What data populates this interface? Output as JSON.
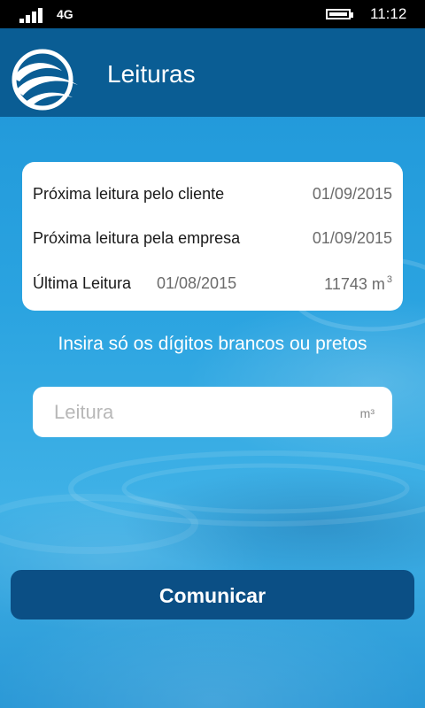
{
  "status_bar": {
    "network": "4G",
    "time": "11:12",
    "icons": [
      "signal-icon",
      "battery-icon"
    ]
  },
  "header": {
    "title": "Leituras",
    "logo": "water-wave-logo"
  },
  "info_card": {
    "next_reading_client": {
      "label": "Próxima leitura pelo cliente",
      "date": "01/09/2015"
    },
    "next_reading_company": {
      "label": "Próxima leitura pela empresa",
      "date": "01/09/2015"
    },
    "last_reading": {
      "label": "Última Leitura",
      "date": "01/08/2015",
      "value": "11743 m",
      "unit_power": "3"
    }
  },
  "instruction": "Insira só os dígitos brancos ou pretos",
  "reading_input": {
    "placeholder": "Leitura",
    "value": "",
    "unit": "m³"
  },
  "submit_button": {
    "label": "Comunicar"
  },
  "colors": {
    "header_bg": "#0a5d94",
    "button_bg": "#0b4f85",
    "water_bg": "#2ea0dc"
  }
}
